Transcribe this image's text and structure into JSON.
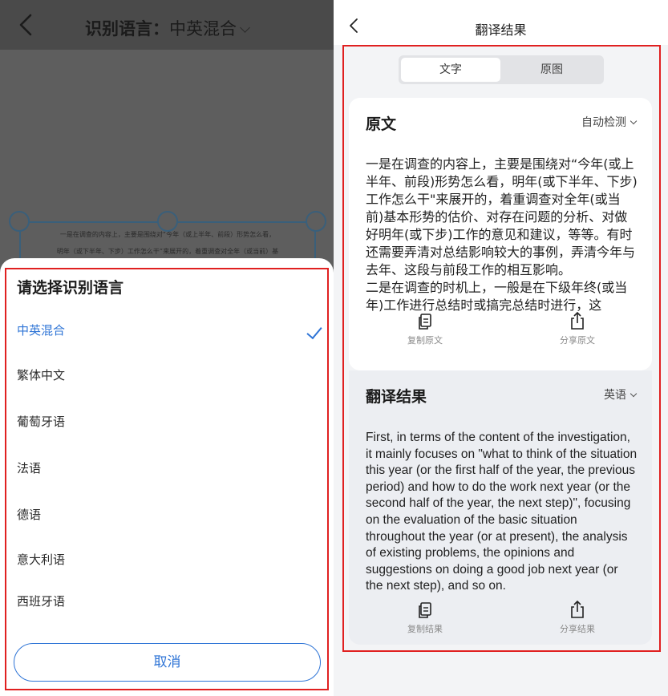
{
  "left": {
    "header": {
      "title_prefix": "识别语言：",
      "title_value": "中英混合"
    },
    "document_preview": {
      "line1": "一是在调查的内容上，主要是围绕对“今年（或上半年、前段）形势怎么看，",
      "line2": "明年（或下半年、下步）工作怎么干”来展开的，着重调查对全年（或当前）基"
    },
    "sheet": {
      "title": "请选择识别语言",
      "options": [
        {
          "label": "中英混合",
          "selected": true
        },
        {
          "label": "繁体中文",
          "selected": false
        },
        {
          "label": "葡萄牙语",
          "selected": false
        },
        {
          "label": "法语",
          "selected": false
        },
        {
          "label": "德语",
          "selected": false
        },
        {
          "label": "意大利语",
          "selected": false
        },
        {
          "label": "西班牙语",
          "selected": false
        }
      ],
      "cancel_label": "取消"
    },
    "accent_color": "#2e74d6"
  },
  "right": {
    "header": {
      "title": "翻译结果"
    },
    "segment": {
      "tabs": [
        "文字",
        "原图"
      ],
      "active": "文字"
    },
    "original": {
      "title": "原文",
      "language": "自动检测",
      "text": "一是在调查的内容上，主要是围绕对“今年(或上半年、前段)形势怎么看，明年(或下半年、下步)工作怎么干\"来展开的，着重调查对全年(或当前)基本形势的估价、对存在问题的分析、对做好明年(或下步)工作的意见和建议，等等。有时还需要弄清对总结影响较大的事例，弄清今年与去年、这段与前段工作的相互影响。\n二是在调查的时机上，一般是在下级年终(或当年)工作进行总结时或搞完总结时进行，这",
      "copy_label": "复制原文",
      "share_label": "分享原文"
    },
    "translation": {
      "title": "翻译结果",
      "language": "英语",
      "text": "First, in terms of the content of the investigation, it mainly focuses on \"what to think of the situation this year (or the first half of the year, the previous period) and how to do the work next year (or the second half of the year, the next step)\", focusing on the evaluation of the basic situation throughout the year (or at present), the analysis of existing problems, the opinions and suggestions on doing a good job next year (or the next step), and so on.",
      "copy_label": "复制结果",
      "share_label": "分享结果"
    }
  },
  "annotation_color": "#e02020"
}
